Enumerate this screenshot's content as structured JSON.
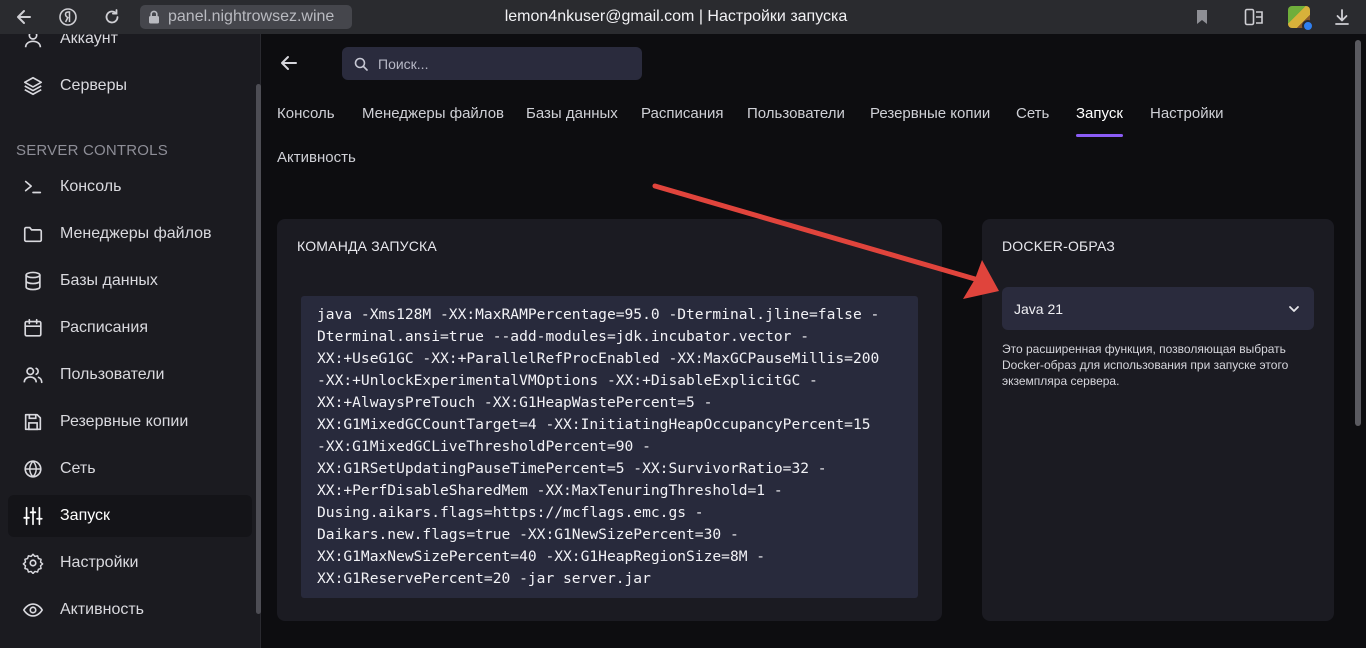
{
  "browser": {
    "url": "panel.nightrowsez.wine",
    "window_title": "lemon4nkuser@gmail.com | Настройки запуска"
  },
  "sidebar": {
    "section_label": "SERVER CONTROLS",
    "top_items": [
      {
        "label": "Аккаунт",
        "icon": "user-icon"
      },
      {
        "label": "Серверы",
        "icon": "layers-icon"
      }
    ],
    "items": [
      {
        "label": "Консоль",
        "icon": "terminal-icon"
      },
      {
        "label": "Менеджеры файлов",
        "icon": "folder-icon"
      },
      {
        "label": "Базы данных",
        "icon": "database-icon"
      },
      {
        "label": "Расписания",
        "icon": "calendar-icon"
      },
      {
        "label": "Пользователи",
        "icon": "users-icon"
      },
      {
        "label": "Резервные копии",
        "icon": "save-icon"
      },
      {
        "label": "Сеть",
        "icon": "globe-icon"
      },
      {
        "label": "Запуск",
        "icon": "sliders-icon",
        "active": true
      },
      {
        "label": "Настройки",
        "icon": "gear-icon"
      },
      {
        "label": "Активность",
        "icon": "eye-icon"
      }
    ]
  },
  "search": {
    "placeholder": "Поиск..."
  },
  "tabs": [
    "Консоль",
    "Менеджеры файлов",
    "Базы данных",
    "Расписания",
    "Пользователи",
    "Резервные копии",
    "Сеть",
    "Запуск",
    "Настройки",
    "Активность"
  ],
  "active_tab": "Запуск",
  "startup": {
    "title": "КОМАНДА ЗАПУСКА",
    "command_lines": [
      "java -Xms128M -XX:MaxRAMPercentage=95.0 -Dterminal.jline=false -",
      "Dterminal.ansi=true --add-modules=jdk.incubator.vector -",
      "XX:+UseG1GC -XX:+ParallelRefProcEnabled -XX:MaxGCPauseMillis=200",
      "-XX:+UnlockExperimentalVMOptions -XX:+DisableExplicitGC -",
      "XX:+AlwaysPreTouch -XX:G1HeapWastePercent=5 -",
      "XX:G1MixedGCCountTarget=4 -XX:InitiatingHeapOccupancyPercent=15",
      "-XX:G1MixedGCLiveThresholdPercent=90 -",
      "XX:G1RSetUpdatingPauseTimePercent=5 -XX:SurvivorRatio=32 -",
      "XX:+PerfDisableSharedMem -XX:MaxTenuringThreshold=1 -",
      "Dusing.aikars.flags=https://mcflags.emc.gs -",
      "Daikars.new.flags=true -XX:G1NewSizePercent=30 -",
      "XX:G1MaxNewSizePercent=40 -XX:G1HeapRegionSize=8M -",
      "XX:G1ReservePercent=20 -jar server.jar"
    ]
  },
  "docker": {
    "title": "DOCKER-ОБРАЗ",
    "selected": "Java 21",
    "help": "Это расширенная функция, позволяющая выбрать Docker-образ для использования при запуске этого экземпляра сервера."
  },
  "colors": {
    "accent": "#8b5cf6",
    "arrow": "#e0443c",
    "card": "#1b1b22",
    "code_bg": "#282a3c"
  }
}
